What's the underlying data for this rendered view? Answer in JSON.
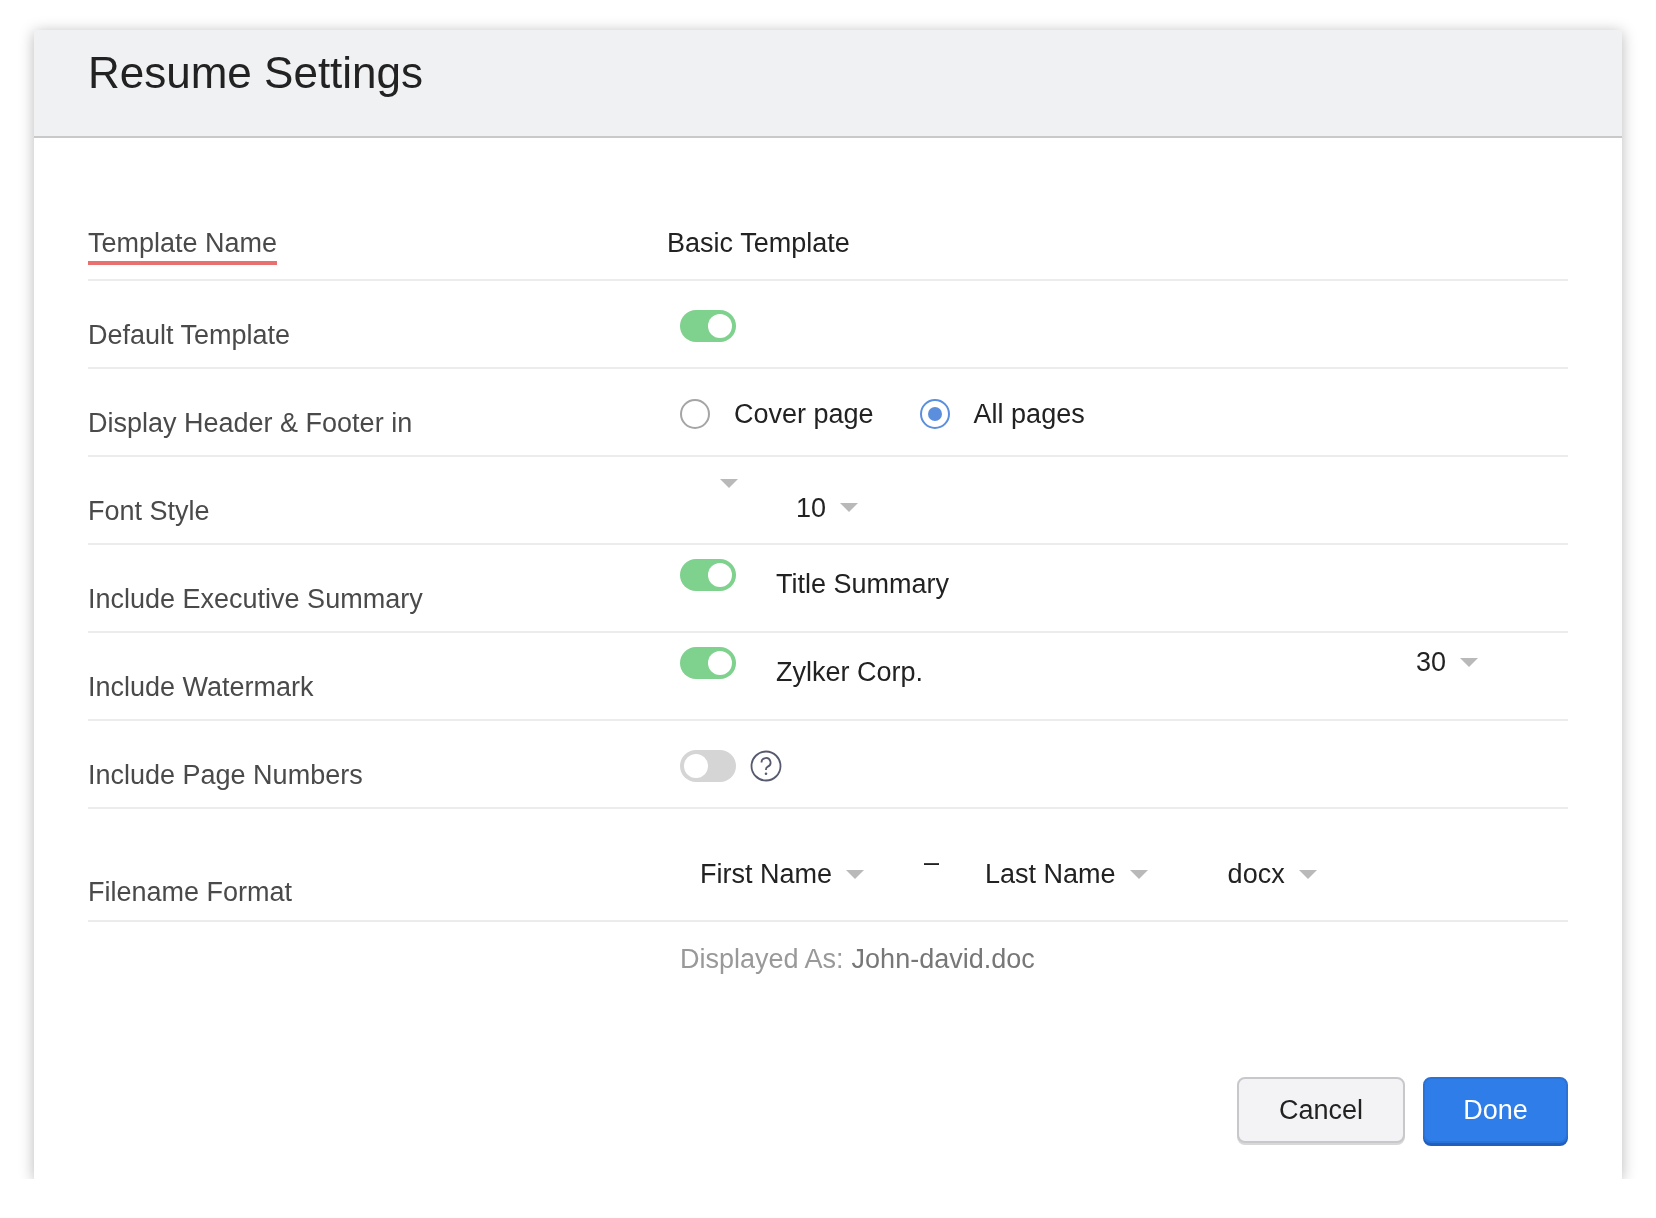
{
  "title": "Resume Settings",
  "rows": [
    {
      "kind": "text",
      "label": "Template Name",
      "underlined": true,
      "value": "Basic Template"
    },
    {
      "kind": "toggle",
      "label": "Default Template",
      "underlined": false,
      "on": true
    },
    {
      "kind": "radio",
      "label": "Display Header & Footer in",
      "underlined": false,
      "options": [
        {
          "label": "Cover page",
          "selected": false
        },
        {
          "label": "All pages",
          "selected": true
        }
      ]
    },
    {
      "kind": "font",
      "label": "Font Style",
      "underlined": false,
      "size": "10"
    },
    {
      "kind": "toggle_text",
      "label": "Include Executive Summary",
      "underlined": false,
      "on": true,
      "text": "Title Summary"
    },
    {
      "kind": "watermark",
      "label": "Include Watermark",
      "underlined": false,
      "on": true,
      "text": "Zylker Corp.",
      "size": "30"
    },
    {
      "kind": "toggle_help",
      "label": "Include Page Numbers",
      "underlined": false,
      "on": false
    },
    {
      "kind": "filename",
      "label": "Filename Format",
      "underlined": false,
      "parts": [
        "First Name",
        "Last Name",
        "docx"
      ],
      "separator": "–"
    }
  ],
  "displayed_as": {
    "label": "Displayed As:",
    "value": "John-david.doc"
  },
  "buttons": [
    {
      "label": "Cancel",
      "kind": "secondary"
    },
    {
      "label": "Done",
      "kind": "primary"
    }
  ]
}
